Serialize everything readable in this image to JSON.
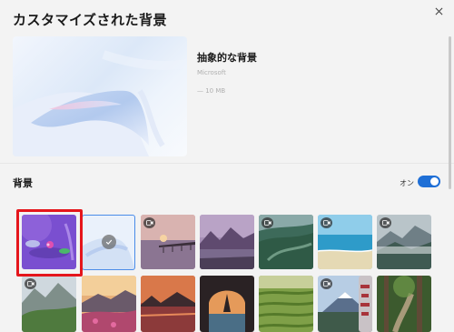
{
  "page": {
    "title": "カスタマイズされた背景"
  },
  "preview": {
    "name": "抽象的な背景",
    "meta_line_1": "Microsoft",
    "meta_line_2": "— 10 MB"
  },
  "section": {
    "label": "背景"
  },
  "toggle": {
    "label": "オン",
    "state": true,
    "color": "#1f6fd6"
  },
  "highlight_color": "#e5161c",
  "thumbnails": [
    {
      "name": "purple-flower",
      "video": false,
      "selected": false,
      "highlighted": true
    },
    {
      "name": "abstract-white",
      "video": false,
      "selected": true,
      "highlighted": false
    },
    {
      "name": "pier-sunset",
      "video": true,
      "selected": false,
      "highlighted": false
    },
    {
      "name": "lake-mountains",
      "video": false,
      "selected": false,
      "highlighted": false
    },
    {
      "name": "green-valley",
      "video": true,
      "selected": false,
      "highlighted": false
    },
    {
      "name": "tropical-beach",
      "video": true,
      "selected": false,
      "highlighted": false
    },
    {
      "name": "misty-mountains",
      "video": true,
      "selected": false,
      "highlighted": false
    },
    {
      "name": "alpine-valley",
      "video": true,
      "selected": false,
      "highlighted": false
    },
    {
      "name": "flower-mountain-sunrise",
      "video": false,
      "selected": false,
      "highlighted": false
    },
    {
      "name": "red-sunset-reflection",
      "video": false,
      "selected": false,
      "highlighted": false
    },
    {
      "name": "sea-arch",
      "video": false,
      "selected": false,
      "highlighted": false
    },
    {
      "name": "rice-terraces",
      "video": false,
      "selected": false,
      "highlighted": false
    },
    {
      "name": "mount-fuji-pagoda",
      "video": true,
      "selected": false,
      "highlighted": false
    },
    {
      "name": "forest-path",
      "video": false,
      "selected": false,
      "highlighted": false
    }
  ]
}
